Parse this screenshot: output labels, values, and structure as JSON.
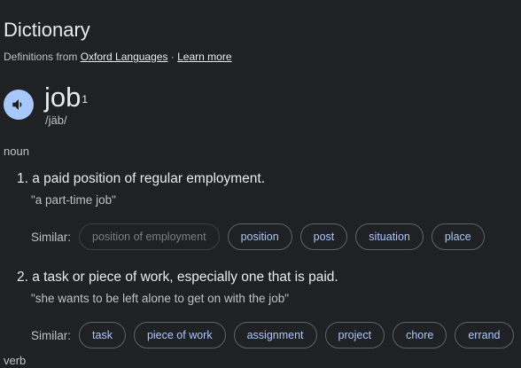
{
  "header": {
    "title": "Dictionary",
    "source_prefix": "Definitions from ",
    "source_link": "Oxford Languages",
    "separator": " · ",
    "learn_more": "Learn more"
  },
  "entry": {
    "word": "job",
    "superscript": "1",
    "phonetic": "/jäb/"
  },
  "noun": {
    "label": "noun",
    "senses": [
      {
        "definition": "1. a paid position of regular employment.",
        "example": "\"a part-time job\"",
        "similar_label": "Similar:",
        "similar": [
          {
            "text": "position of employment",
            "disabled": true
          },
          {
            "text": "position",
            "disabled": false
          },
          {
            "text": "post",
            "disabled": false
          },
          {
            "text": "situation",
            "disabled": false
          },
          {
            "text": "place",
            "disabled": false
          }
        ]
      },
      {
        "definition": "2. a task or piece of work, especially one that is paid.",
        "example": "\"she wants to be left alone to get on with the job\"",
        "similar_label": "Similar:",
        "similar": [
          {
            "text": "task",
            "disabled": false
          },
          {
            "text": "piece of work",
            "disabled": false
          },
          {
            "text": "assignment",
            "disabled": false
          },
          {
            "text": "project",
            "disabled": false
          },
          {
            "text": "chore",
            "disabled": false
          },
          {
            "text": "errand",
            "disabled": false
          }
        ]
      }
    ]
  },
  "verb": {
    "label": "verb"
  },
  "icons": {
    "speaker": "speaker-icon"
  },
  "colors": {
    "background": "#202124",
    "chip_text": "#a8c7fa",
    "speaker_bg": "#a8c7fa"
  }
}
